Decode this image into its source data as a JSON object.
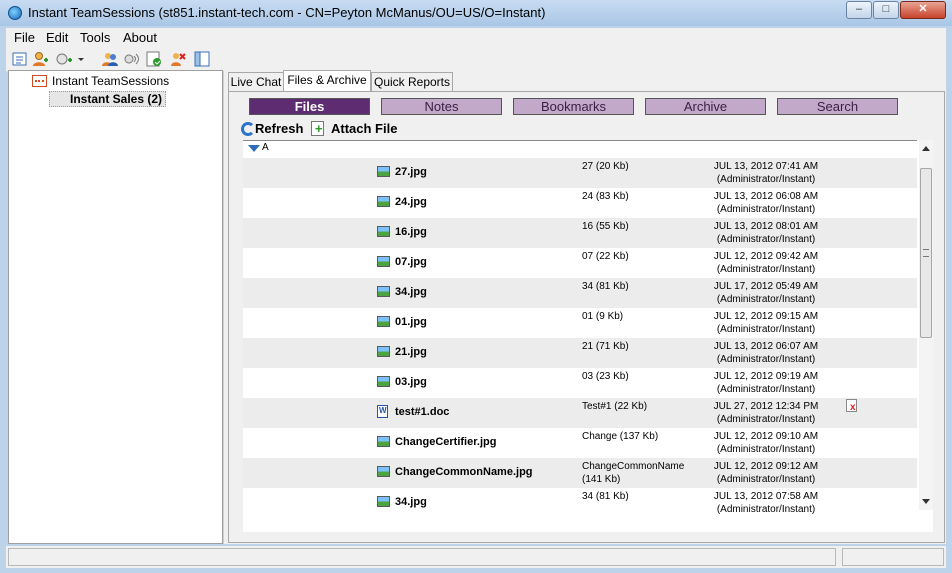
{
  "window": {
    "title": "Instant TeamSessions (st851.instant-tech.com - CN=Peyton McManus/OU=US/O=Instant)",
    "controls": {
      "minimize": "–",
      "maximize": "□",
      "close": "✕"
    }
  },
  "menu": [
    "File",
    "Edit",
    "Tools",
    "About"
  ],
  "toolbar_icons": [
    "settings-icon",
    "add-user-icon",
    "add-group-icon",
    "dropdown-arrow-icon",
    "users-icon",
    "broadcast-icon",
    "checklist-icon",
    "remove-icon",
    "panel-icon"
  ],
  "tree": {
    "root": "Instant TeamSessions",
    "child": "Instant Sales (2)"
  },
  "tabs": [
    "Live Chat",
    "Files & Archive",
    "Quick Reports"
  ],
  "active_tab": "Files & Archive",
  "subtabs": [
    "Files",
    "Notes",
    "Bookmarks",
    "Archive",
    "Search"
  ],
  "active_subtab": "Files",
  "actions": {
    "refresh": "Refresh",
    "attach": "Attach File"
  },
  "group": "A",
  "files": [
    {
      "name": "27.jpg",
      "size": "27 (20 Kb)",
      "date": "JUL 13, 2012 07:41 AM",
      "by": "(Administrator/Instant)",
      "type": "image"
    },
    {
      "name": "24.jpg",
      "size": "24 (83 Kb)",
      "date": "JUL 13, 2012 06:08 AM",
      "by": "(Administrator/Instant)",
      "type": "image"
    },
    {
      "name": "16.jpg",
      "size": "16 (55 Kb)",
      "date": "JUL 13, 2012 08:01 AM",
      "by": "(Administrator/Instant)",
      "type": "image"
    },
    {
      "name": "07.jpg",
      "size": "07 (22 Kb)",
      "date": "JUL 12, 2012 09:42 AM",
      "by": "(Administrator/Instant)",
      "type": "image"
    },
    {
      "name": "34.jpg",
      "size": "34 (81 Kb)",
      "date": "JUL 17, 2012 05:49 AM",
      "by": "(Administrator/Instant)",
      "type": "image"
    },
    {
      "name": "01.jpg",
      "size": "01 (9 Kb)",
      "date": "JUL 12, 2012 09:15 AM",
      "by": "(Administrator/Instant)",
      "type": "image"
    },
    {
      "name": "21.jpg",
      "size": "21 (71 Kb)",
      "date": "JUL 13, 2012 06:07 AM",
      "by": "(Administrator/Instant)",
      "type": "image"
    },
    {
      "name": "03.jpg",
      "size": "03 (23 Kb)",
      "date": "JUL 12, 2012 09:19 AM",
      "by": "(Administrator/Instant)",
      "type": "image"
    },
    {
      "name": "test#1.doc",
      "size": "Test#1 (22 Kb)",
      "date": "JUL 27, 2012 12:34 PM",
      "by": "(Administrator/Instant)",
      "type": "doc",
      "deletable": true
    },
    {
      "name": "ChangeCertifier.jpg",
      "size": "Change (137 Kb)",
      "date": "JUL 12, 2012 09:10 AM",
      "by": "(Administrator/Instant)",
      "type": "image"
    },
    {
      "name": "ChangeCommonName.jpg",
      "size": "ChangeCommonName (141 Kb)",
      "date": "JUL 12, 2012 09:12 AM",
      "by": "(Administrator/Instant)",
      "type": "image"
    },
    {
      "name": "34.jpg",
      "size": "34 (81 Kb)",
      "date": "JUL 13, 2012 07:58 AM",
      "by": "(Administrator/Instant)",
      "type": "image"
    }
  ]
}
